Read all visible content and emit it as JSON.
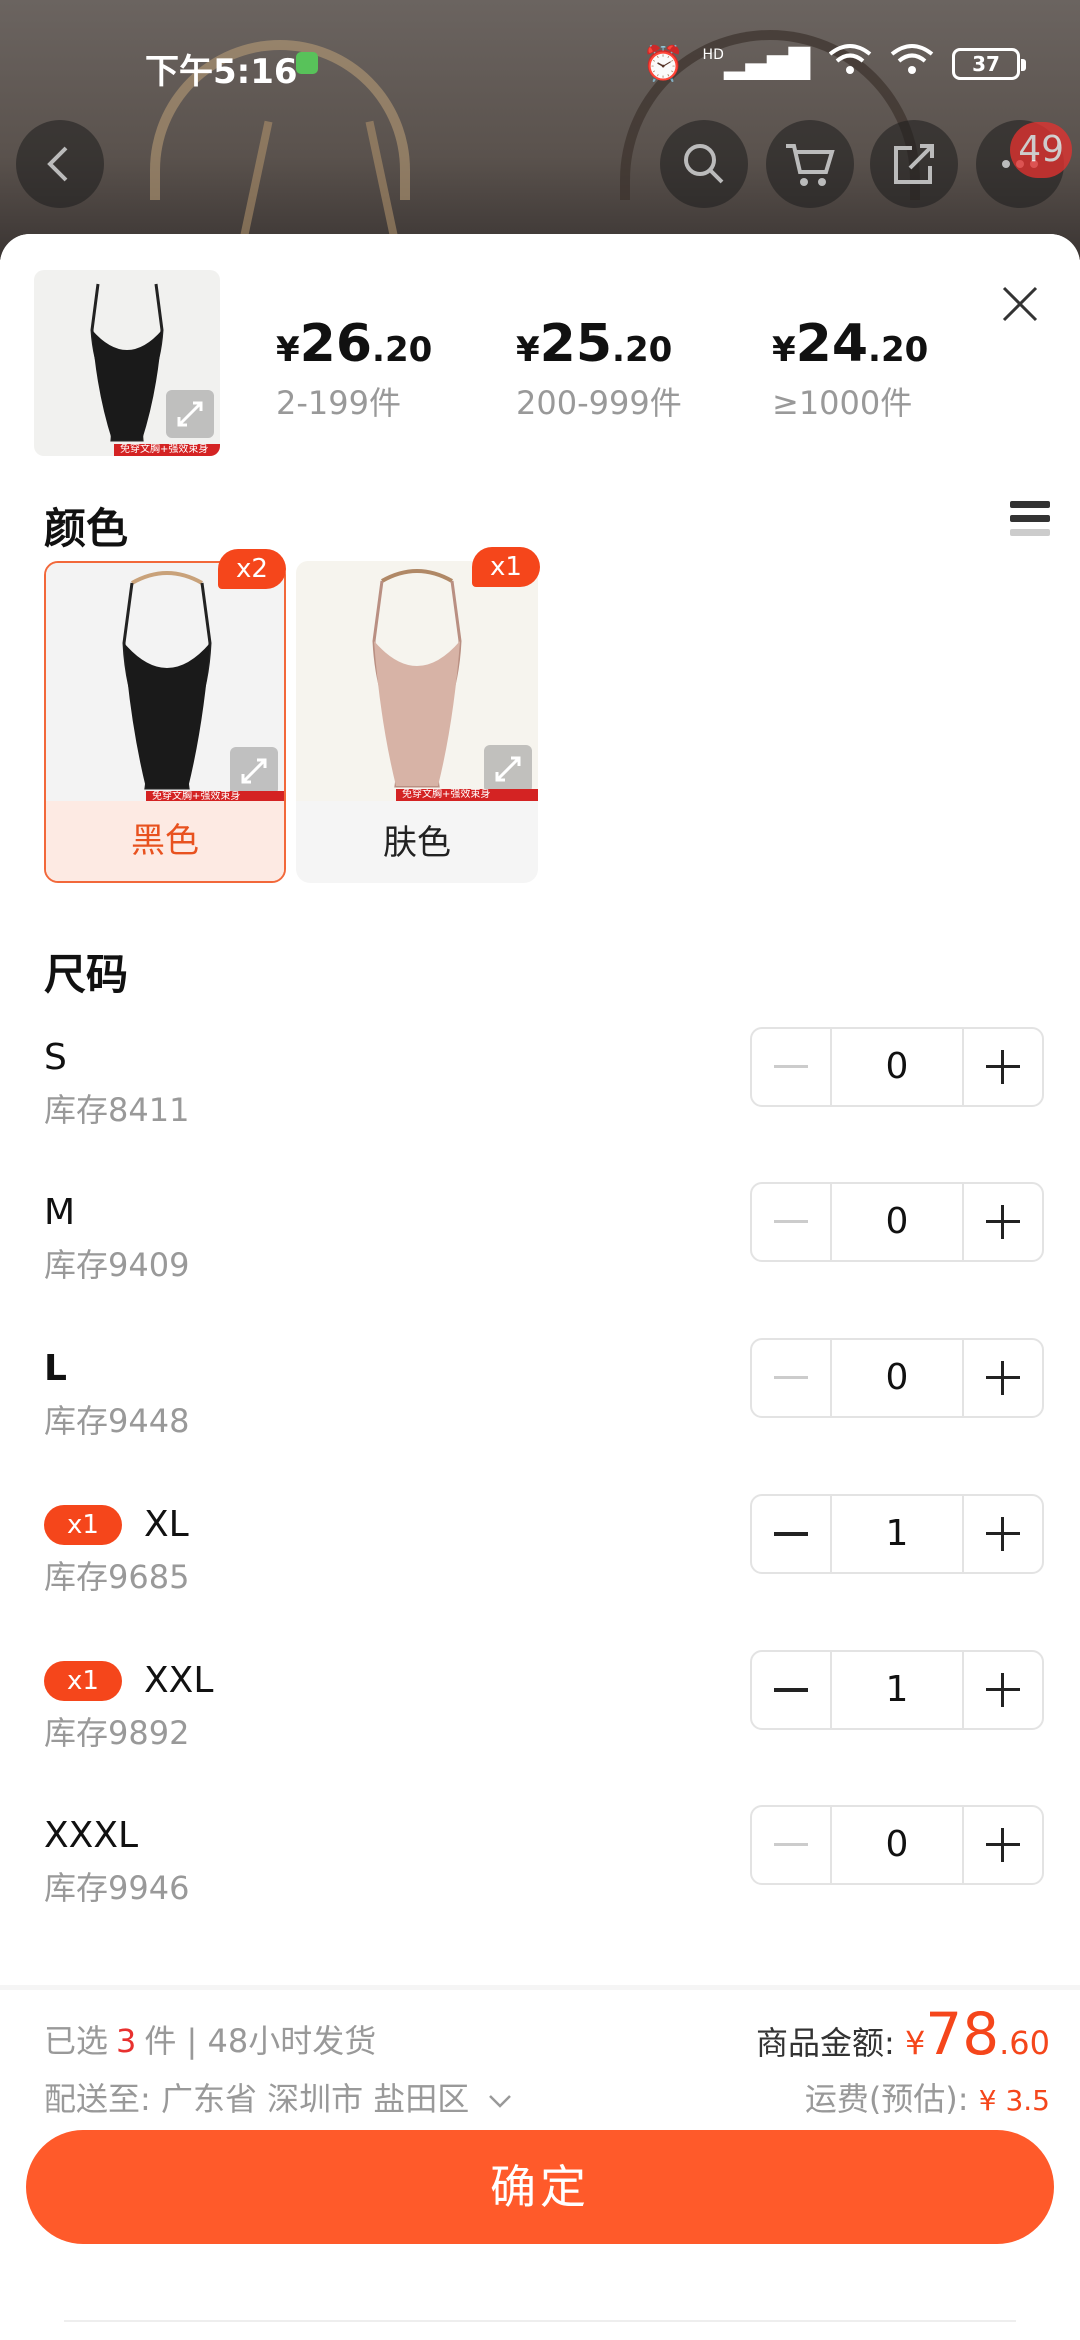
{
  "status_bar": {
    "time": "下午5:16",
    "network_label": "HD",
    "battery": "37"
  },
  "nav": {
    "cart_badge": "49",
    "icons": [
      "back-icon",
      "search-icon",
      "cart-icon",
      "share-icon",
      "more-icon"
    ]
  },
  "product": {
    "thumb_strip_text": "免穿文胸+强效束身",
    "prices": [
      {
        "currency": "¥",
        "int": "26",
        "dec": ".20",
        "range": "2-199件"
      },
      {
        "currency": "¥",
        "int": "25",
        "dec": ".20",
        "range": "200-999件"
      },
      {
        "currency": "¥",
        "int": "24",
        "dec": ".20",
        "range": "≥1000件"
      }
    ]
  },
  "color_section": {
    "title": "颜色",
    "options": [
      {
        "label": "黑色",
        "badge": "x2",
        "selected": true,
        "strip_text": "免穿文胸+强效束身"
      },
      {
        "label": "肤色",
        "badge": "x1",
        "selected": false,
        "strip_text": "免穿文胸+强效束身"
      }
    ]
  },
  "size_section": {
    "title": "尺码",
    "rows": [
      {
        "name": "S",
        "stock": "库存8411",
        "qty": "0",
        "tag": ""
      },
      {
        "name": "M",
        "stock": "库存9409",
        "qty": "0",
        "tag": ""
      },
      {
        "name": "L",
        "stock": "库存9448",
        "qty": "0",
        "tag": ""
      },
      {
        "name": "XL",
        "stock": "库存9685",
        "qty": "1",
        "tag": "x1"
      },
      {
        "name": "XXL",
        "stock": "库存9892",
        "qty": "1",
        "tag": "x1"
      },
      {
        "name": "XXXL",
        "stock": "库存9946",
        "qty": "0",
        "tag": ""
      }
    ]
  },
  "footer": {
    "selected_prefix": "已选",
    "selected_count": "3",
    "selected_suffix": "件 | 48小时发货",
    "ship_to": "配送至:  广东省 深圳市 盐田区",
    "amount_label": "商品金额:",
    "amount_currency": "¥",
    "amount_int": "78",
    "amount_dec": ".60",
    "freight_label": "运费(预估):",
    "freight_value": "¥ 3.5",
    "confirm_label": "确定"
  },
  "colors": {
    "accent": "#ff5a2a",
    "badge": "#f5461b",
    "selected_bg": "#fdeae3"
  }
}
